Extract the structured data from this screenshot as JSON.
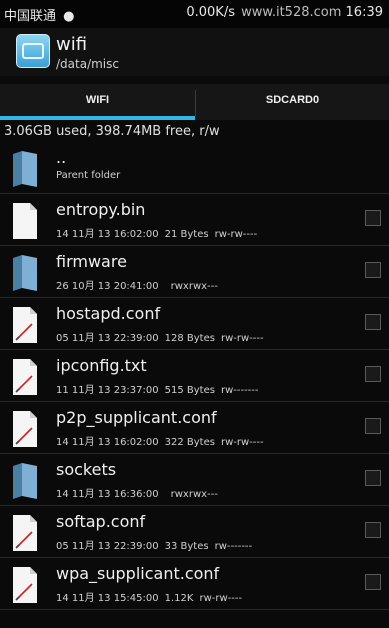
{
  "status_bar": {
    "carrier": "中国联通",
    "net_speed": "0.00K/s",
    "watermark": "www.it528.com",
    "time": "16:39"
  },
  "app": {
    "title": "wifi",
    "path": "/data/misc"
  },
  "tabs": [
    {
      "label": "WIFI",
      "selected": true
    },
    {
      "label": "SDCARD0",
      "selected": false
    }
  ],
  "storage_info": "3.06GB used, 398.74MB free, r/w",
  "parent": {
    "name": "..",
    "desc": "Parent folder"
  },
  "files": [
    {
      "name": "entropy.bin",
      "date": "14 11月 13 16:02:00",
      "size": "21 Bytes",
      "perm": "rw-rw----",
      "type": "file"
    },
    {
      "name": "firmware",
      "date": "26 10月 13 20:41:00",
      "size": "",
      "perm": "rwxrwx---",
      "type": "folder"
    },
    {
      "name": "hostapd.conf",
      "date": "05 11月 13 22:39:00",
      "size": "128 Bytes",
      "perm": "rw-rw----",
      "type": "text"
    },
    {
      "name": "ipconfig.txt",
      "date": "11 11月 13 23:37:00",
      "size": "515 Bytes",
      "perm": "rw-------",
      "type": "text"
    },
    {
      "name": "p2p_supplicant.conf",
      "date": "14 11月 13 16:02:00",
      "size": "322 Bytes",
      "perm": "rw-rw----",
      "type": "text"
    },
    {
      "name": "sockets",
      "date": "14 11月 13 16:36:00",
      "size": "",
      "perm": "rwxrwx---",
      "type": "folder"
    },
    {
      "name": "softap.conf",
      "date": "05 11月 13 22:39:00",
      "size": "33 Bytes",
      "perm": "rw-------",
      "type": "text"
    },
    {
      "name": "wpa_supplicant.conf",
      "date": "14 11月 13 15:45:00",
      "size": "1.12K",
      "perm": "rw-rw----",
      "type": "text"
    }
  ],
  "colors": {
    "accent": "#33b5e5",
    "background": "#0a0a0a"
  }
}
